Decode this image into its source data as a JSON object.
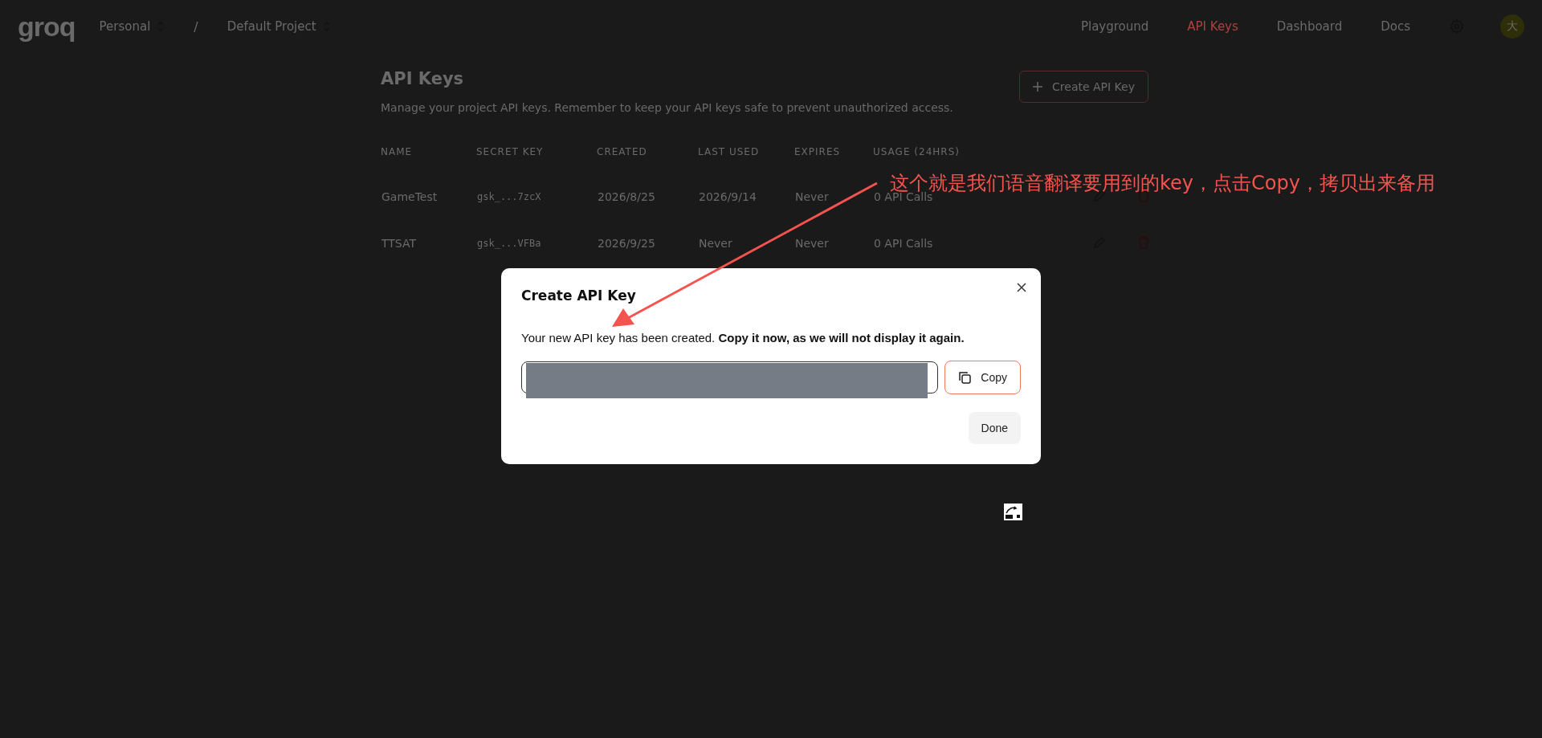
{
  "header": {
    "logo": "groq",
    "breadcrumbs": [
      {
        "label": "Personal"
      },
      {
        "label": "Default Project"
      }
    ],
    "separator": "/",
    "nav": [
      {
        "label": "Playground",
        "selected": false
      },
      {
        "label": "API Keys",
        "selected": true
      },
      {
        "label": "Dashboard",
        "selected": false
      },
      {
        "label": "Docs",
        "selected": false
      }
    ],
    "avatar": "大"
  },
  "page": {
    "title": "API Keys",
    "description": "Manage your project API keys. Remember to keep your API keys safe to prevent unauthorized access.",
    "create_button": "Create API Key"
  },
  "table": {
    "columns": [
      "NAME",
      "SECRET KEY",
      "CREATED",
      "LAST USED",
      "EXPIRES",
      "USAGE (24HRS)"
    ],
    "rows": [
      {
        "cells": [
          "GameTest",
          "gsk_...7zcX",
          "2026/8/25",
          "2026/9/14",
          "Never",
          "0 API Calls"
        ]
      },
      {
        "cells": [
          "TTSAT",
          "gsk_...VFBa",
          "2026/9/25",
          "Never",
          "Never",
          "0 API Calls"
        ]
      }
    ]
  },
  "modal": {
    "title": "Create API Key",
    "message": "Your new API key has been created. **Copy it now, as we will not display it again.**",
    "copy_button": "Copy",
    "done_button": "Done"
  },
  "annotation": {
    "text": "这个就是我们语音翻译要用到的key，点击Copy，拷贝出来备用"
  }
}
